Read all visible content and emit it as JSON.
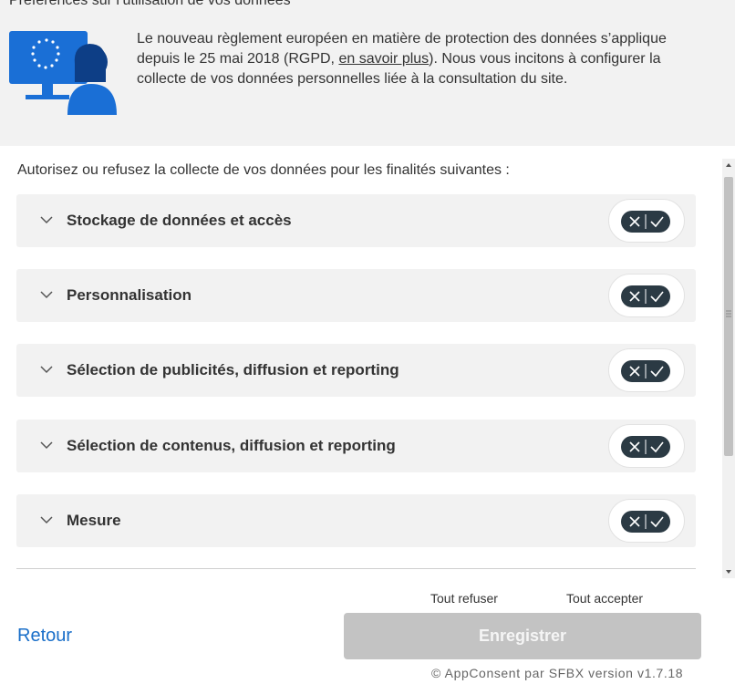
{
  "header": {
    "title": "Préférences sur l’utilisation de vos données",
    "text_before_link": "Le nouveau règlement européen en matière de protection des données s’applique depuis le 25 mai 2018 (RGPD, ",
    "link_text": "en savoir plus",
    "text_after_link": "). Nous vous incitons à configurer la collecte de vos données personnelles liée à la consultation du site."
  },
  "intro": "Autorisez ou refusez la collecte de vos données pour les finalités suivantes :",
  "purposes": [
    {
      "label": "Stockage de données et accès"
    },
    {
      "label": "Personnalisation"
    },
    {
      "label": "Sélection de publicités, diffusion et reporting"
    },
    {
      "label": "Sélection de contenus, diffusion et reporting"
    },
    {
      "label": "Mesure"
    }
  ],
  "actions": {
    "refuse_all": "Tout refuser",
    "accept_all": "Tout accepter",
    "back": "Retour",
    "save": "Enregistrer"
  },
  "footer": "© AppConsent par SFBX version v1.7.18",
  "colors": {
    "header_bg": "#f2f2f2",
    "toggle_bg": "#2b3a44",
    "link_blue": "#1a6fc9",
    "illustration_blue": "#1a6fd6",
    "save_disabled": "#c3c3c3"
  },
  "icons": {
    "illustration": "eu-monitor-person-illustration",
    "expand": "chevron-down-icon",
    "toggle_off": "x-icon",
    "toggle_on": "check-icon"
  }
}
